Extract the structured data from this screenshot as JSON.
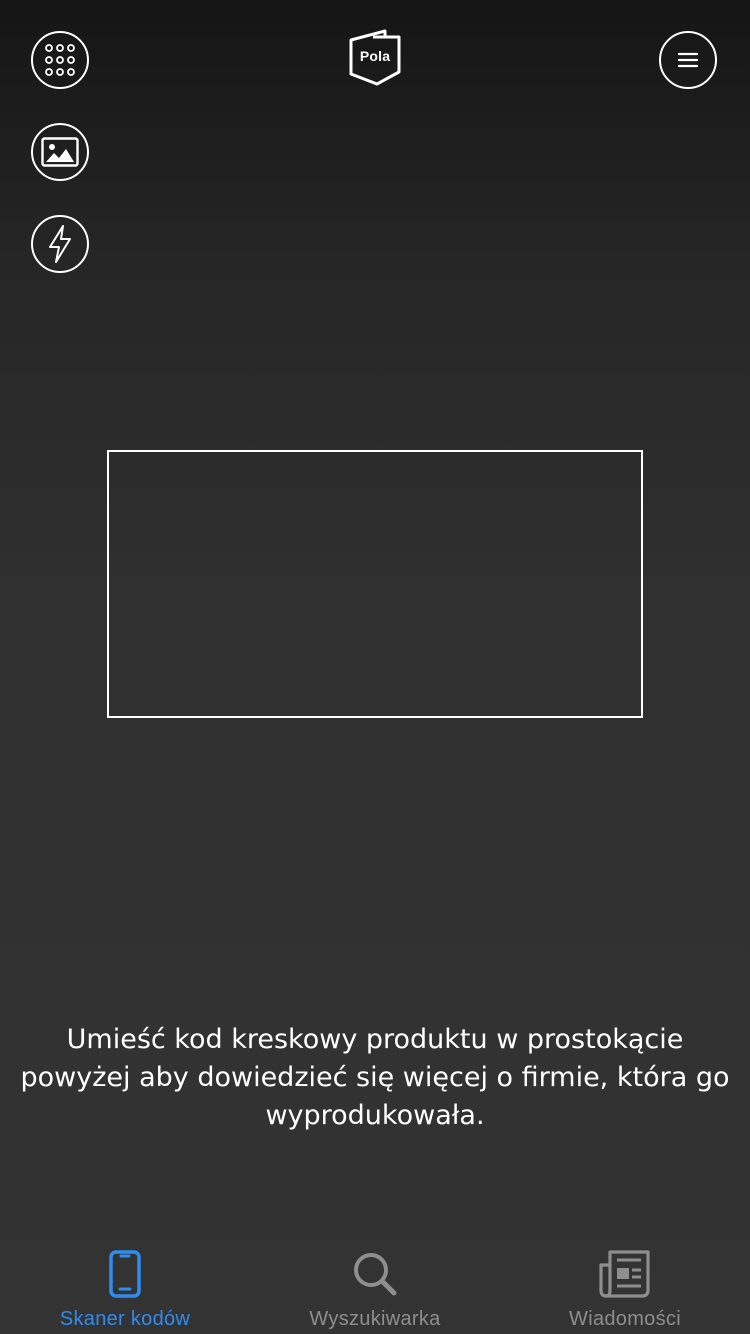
{
  "header": {
    "logo_text": "Pola",
    "buttons": {
      "keypad_icon": "keypad-icon",
      "gallery_icon": "image-icon",
      "flash_icon": "flash-icon",
      "menu_icon": "hamburger-menu-icon"
    }
  },
  "scanner": {
    "instruction": "Umieść kod kreskowy produktu w prostokącie powyżej aby dowiedzieć się więcej o firmie, która go wyprodukowała."
  },
  "tabbar": {
    "active_color": "#2f8cf0",
    "inactive_color": "#8e8e8e",
    "tabs": [
      {
        "label": "Skaner kodów",
        "icon": "phone-icon",
        "active": true
      },
      {
        "label": "Wyszukiwarka",
        "icon": "search-icon",
        "active": false
      },
      {
        "label": "Wiadomości",
        "icon": "newspaper-icon",
        "active": false
      }
    ]
  }
}
